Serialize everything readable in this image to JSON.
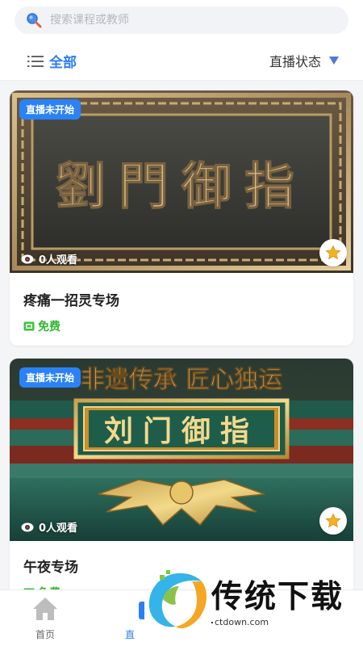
{
  "search": {
    "placeholder": "搜索课程或教师"
  },
  "filter": {
    "all_label": "全部",
    "status_label": "直播状态"
  },
  "courses": [
    {
      "badge": "直播未开始",
      "viewers": "0人观看",
      "title": "疼痛一招灵专场",
      "price": "免费",
      "plaque_text": "劉門御指"
    },
    {
      "badge": "直播未开始",
      "viewers": "0人观看",
      "title": "午夜专场",
      "price": "免费",
      "banner_text": "非遗传承 匠心独运",
      "plaque_text": "刘门御指"
    }
  ],
  "nav": {
    "home_label": "首页",
    "live_label": "直"
  },
  "watermark": {
    "text": "传统下载",
    "url": "ctdown.com"
  },
  "colors": {
    "accent": "#2b7ef5",
    "badge": "#2b82f6",
    "free": "#2db82d",
    "star": "#f5b31b"
  },
  "icons": {
    "search": "search-icon",
    "list": "list-icon",
    "dropdown": "triangle-down-icon",
    "eye": "eye-icon",
    "star": "star-icon",
    "ticket": "ticket-icon",
    "home": "home-icon",
    "live": "live-icon"
  }
}
